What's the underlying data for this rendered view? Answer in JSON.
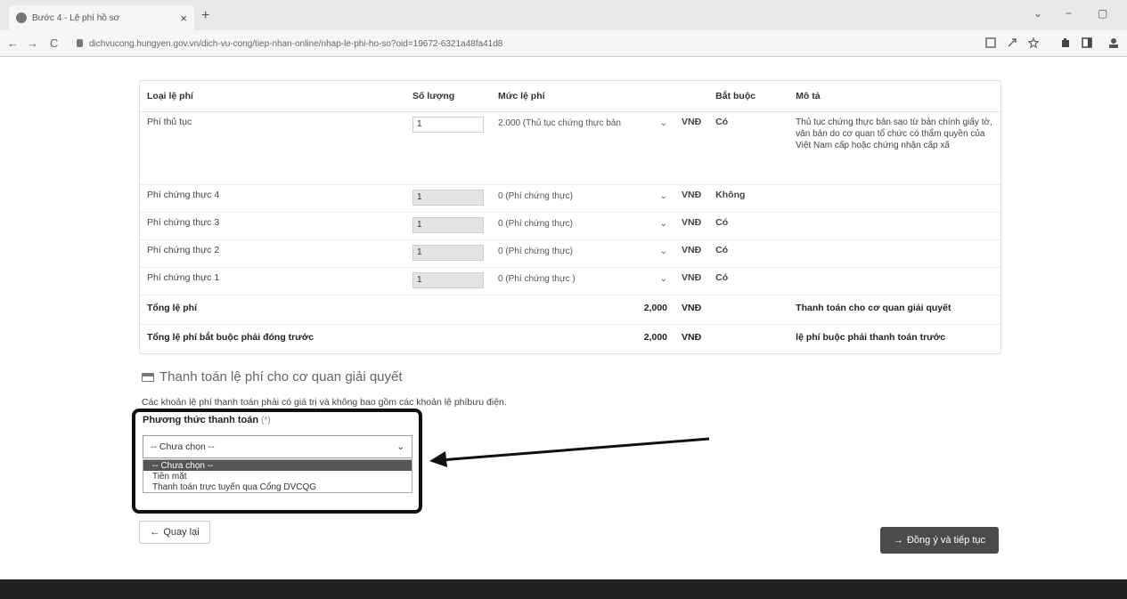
{
  "browser": {
    "tab_title": "Bước 4 - Lệ phí hồ sơ",
    "tab_close": "×",
    "new_tab": "+",
    "url": "dichvucong.hungyen.gov.vn/dich-vu-cong/tiep-nhan-online/nhap-le-phi-ho-so?oid=19672-6321a48fa41d8",
    "back": "←",
    "forward": "→",
    "reload": "C",
    "minimize": "−",
    "maximize": "▢",
    "chevron": "⌄"
  },
  "fee_table": {
    "headers": {
      "loai": "Loại lệ phí",
      "so_luong": "Số lượng",
      "muc": "Mức lệ phí",
      "bat_buoc": "Bắt buộc",
      "mo_ta": "Mô tả"
    },
    "rows": [
      {
        "name": "Phí thủ tục",
        "qty": "1",
        "fee": "2.000 (Thủ tục chứng thực bản",
        "currency": "VNĐ",
        "required": "Có",
        "desc": "Thủ tục chứng thực bản sao từ bản chính giấy tờ, văn bản do cơ quan tổ chức có thẩm quyền của Việt Nam cấp hoặc chứng nhận cấp xã"
      },
      {
        "name": "Phí chứng thực 4",
        "qty": "1",
        "fee": "0 (Phí chứng thực)",
        "currency": "VNĐ",
        "required": "Không",
        "desc": ""
      },
      {
        "name": "Phí chứng thực 3",
        "qty": "1",
        "fee": "0 (Phí chứng thực)",
        "currency": "VNĐ",
        "required": "Có",
        "desc": ""
      },
      {
        "name": "Phí chứng thực 2",
        "qty": "1",
        "fee": "0 (Phí chứng thực)",
        "currency": "VNĐ",
        "required": "Có",
        "desc": ""
      },
      {
        "name": "Phí chứng thực 1",
        "qty": "1",
        "fee": "0 (Phí chứng thực )",
        "currency": "VNĐ",
        "required": "Có",
        "desc": ""
      }
    ],
    "total": {
      "label": "Tổng lệ phí",
      "value": "2,000",
      "currency": "VNĐ",
      "desc": "Thanh toán cho cơ quan giải quyết"
    },
    "required_total": {
      "label": "Tổng lệ phí bắt buộc phải đóng trước",
      "value": "2,000",
      "currency": "VNĐ",
      "desc": "lệ phí buộc phải thanh toán trước"
    }
  },
  "payment": {
    "title": "Thanh toán lệ phí cho cơ quan giải quyết",
    "note": "Các khoản lệ phí thanh toán phải có giá trị và không bao gồm các khoản lệ phíbưu điện.",
    "method_label": "Phương thức thanh toán",
    "required_mark": "(*)",
    "selected": "-- Chưa chọn --",
    "options": [
      "-- Chưa chọn --",
      "Tiền mặt",
      "Thanh toán trực tuyến qua Cổng DVCQG"
    ]
  },
  "actions": {
    "back": "Quay lại",
    "next": "Đồng ý và tiếp tục"
  },
  "colors": {
    "highlight_border": "#111111",
    "primary_button": "#4b4b4b",
    "selected_option": "#555555"
  }
}
